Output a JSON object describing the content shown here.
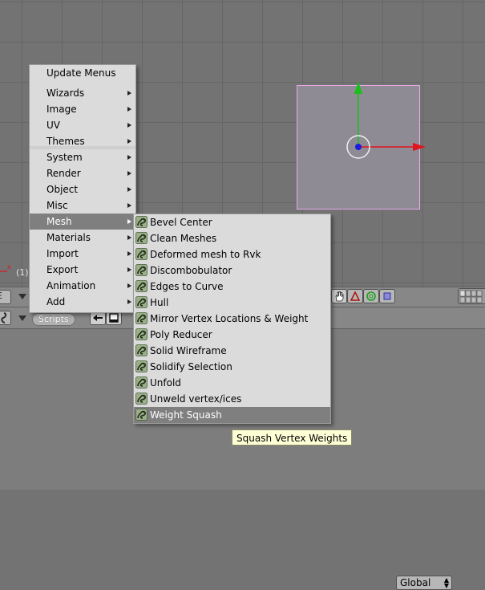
{
  "viewport": {
    "frame_label": "(1)"
  },
  "header": {
    "orientation_select": "Global",
    "scripts_label": "Scripts"
  },
  "scripts_menu": {
    "items": [
      {
        "label": "Update Menus",
        "submenu": false
      },
      {
        "label": "Wizards",
        "submenu": true
      },
      {
        "label": "Image",
        "submenu": true
      },
      {
        "label": "UV",
        "submenu": true
      },
      {
        "label": "Themes",
        "submenu": true
      },
      {
        "label": "System",
        "submenu": true
      },
      {
        "label": "Render",
        "submenu": true
      },
      {
        "label": "Object",
        "submenu": true
      },
      {
        "label": "Misc",
        "submenu": true
      },
      {
        "label": "Mesh",
        "submenu": true,
        "active": true
      },
      {
        "label": "Materials",
        "submenu": true
      },
      {
        "label": "Import",
        "submenu": true
      },
      {
        "label": "Export",
        "submenu": true
      },
      {
        "label": "Animation",
        "submenu": true
      },
      {
        "label": "Add",
        "submenu": true
      }
    ]
  },
  "mesh_submenu": {
    "icon": "python-script-icon",
    "items": [
      "Bevel Center",
      "Clean Meshes",
      "Deformed mesh to Rvk",
      "Discombobulator",
      "Edges to Curve",
      "Hull",
      "Mirror Vertex Locations & Weight",
      "Poly Reducer",
      "Solid Wireframe",
      "Solidify Selection",
      "Unfold",
      "Unweld vertex/ices",
      "Weight Squash"
    ],
    "active_index": 12
  },
  "tooltip": {
    "text": "Squash Vertex Weights"
  },
  "colors": {
    "menu_bg": "#dbdbdb",
    "highlight": "#7f7f7f",
    "axis_x": "#e0141e",
    "axis_y": "#18c018",
    "center_dot": "#1c1cdc",
    "tooltip_bg": "#ffffd6"
  }
}
